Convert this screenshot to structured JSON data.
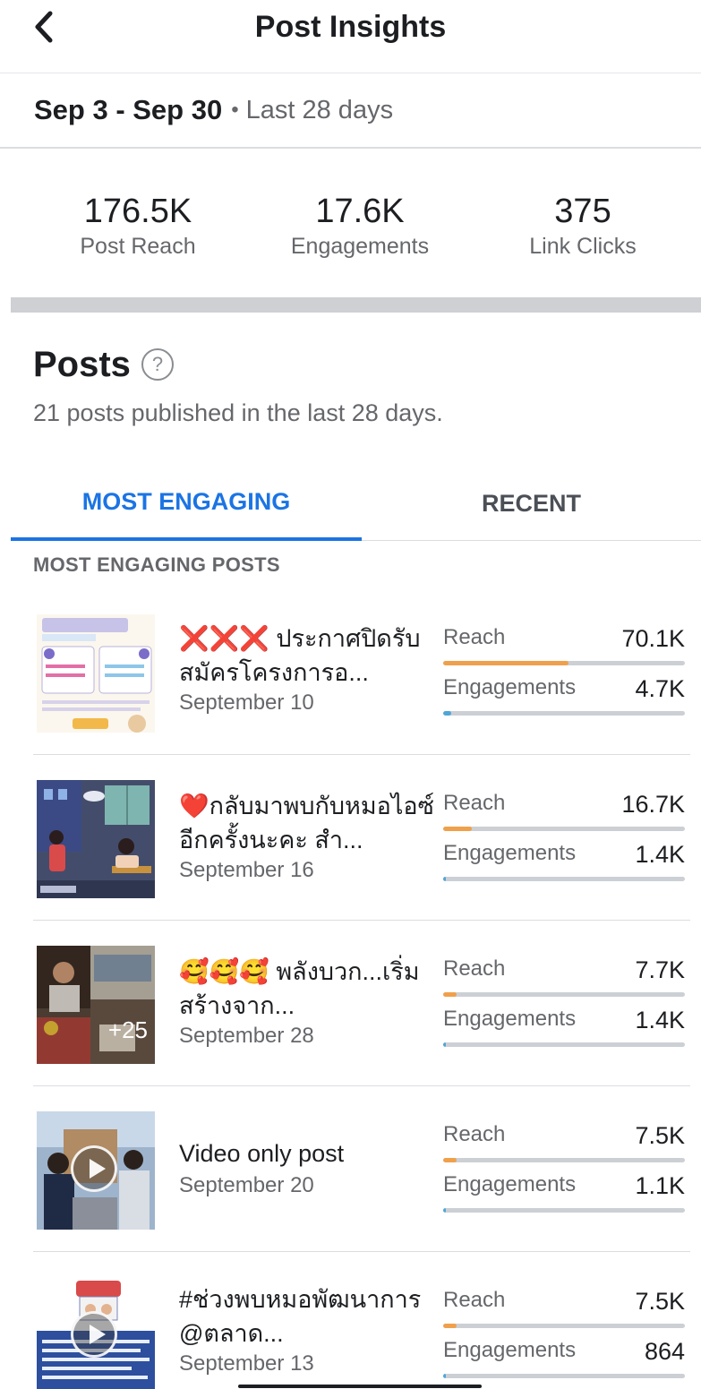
{
  "header": {
    "title": "Post Insights"
  },
  "date_range": {
    "range": "Sep 3 - Sep 30",
    "separator": "•",
    "period": "Last 28 days"
  },
  "stats": [
    {
      "value": "176.5K",
      "label": "Post Reach"
    },
    {
      "value": "17.6K",
      "label": "Engagements"
    },
    {
      "value": "375",
      "label": "Link Clicks"
    }
  ],
  "posts_section": {
    "title": "Posts",
    "help_symbol": "?",
    "subtitle": "21 posts published in the last 28 days."
  },
  "tabs": [
    {
      "label": "MOST ENGAGING",
      "active": true
    },
    {
      "label": "RECENT",
      "active": false
    }
  ],
  "list_header": "MOST ENGAGING POSTS",
  "metric_labels": {
    "reach": "Reach",
    "engagements": "Engagements"
  },
  "colors": {
    "accent": "#1b74e4",
    "reach_bar": "#f0a04b",
    "engagement_bar": "#4fa6d6",
    "track": "#ccd0d5"
  },
  "posts": [
    {
      "title": "❌❌❌ ประกาศปิดรับสมัครโครงการอ...",
      "date": "September 10",
      "reach": "70.1K",
      "engagements": "4.7K",
      "reach_fill": 0.52,
      "eng_fill": 0.035,
      "thumb": "infographic-thumbnail",
      "overlay": ""
    },
    {
      "title": "❤️กลับมาพบกับหมอไอซ์อีกครั้งนะคะ สำ...",
      "date": "September 16",
      "reach": "16.7K",
      "engagements": "1.4K",
      "reach_fill": 0.12,
      "eng_fill": 0.01,
      "thumb": "illustration-thumbnail",
      "overlay": ""
    },
    {
      "title": "🥰🥰🥰 พลังบวก...เริ่มสร้างจาก...",
      "date": "September 28",
      "reach": "7.7K",
      "engagements": "1.4K",
      "reach_fill": 0.055,
      "eng_fill": 0.01,
      "thumb": "photo-album-thumbnail",
      "overlay": "+25"
    },
    {
      "title": "Video only post",
      "date": "September 20",
      "reach": "7.5K",
      "engagements": "1.1K",
      "reach_fill": 0.054,
      "eng_fill": 0.008,
      "thumb": "video-thumbnail",
      "overlay": ""
    },
    {
      "title": "#ช่วงพบหมอพัฒนาการ @ตลาด...",
      "date": "September 13",
      "reach": "7.5K",
      "engagements": "864",
      "reach_fill": 0.054,
      "eng_fill": 0.006,
      "thumb": "video-thumbnail",
      "overlay": ""
    }
  ]
}
